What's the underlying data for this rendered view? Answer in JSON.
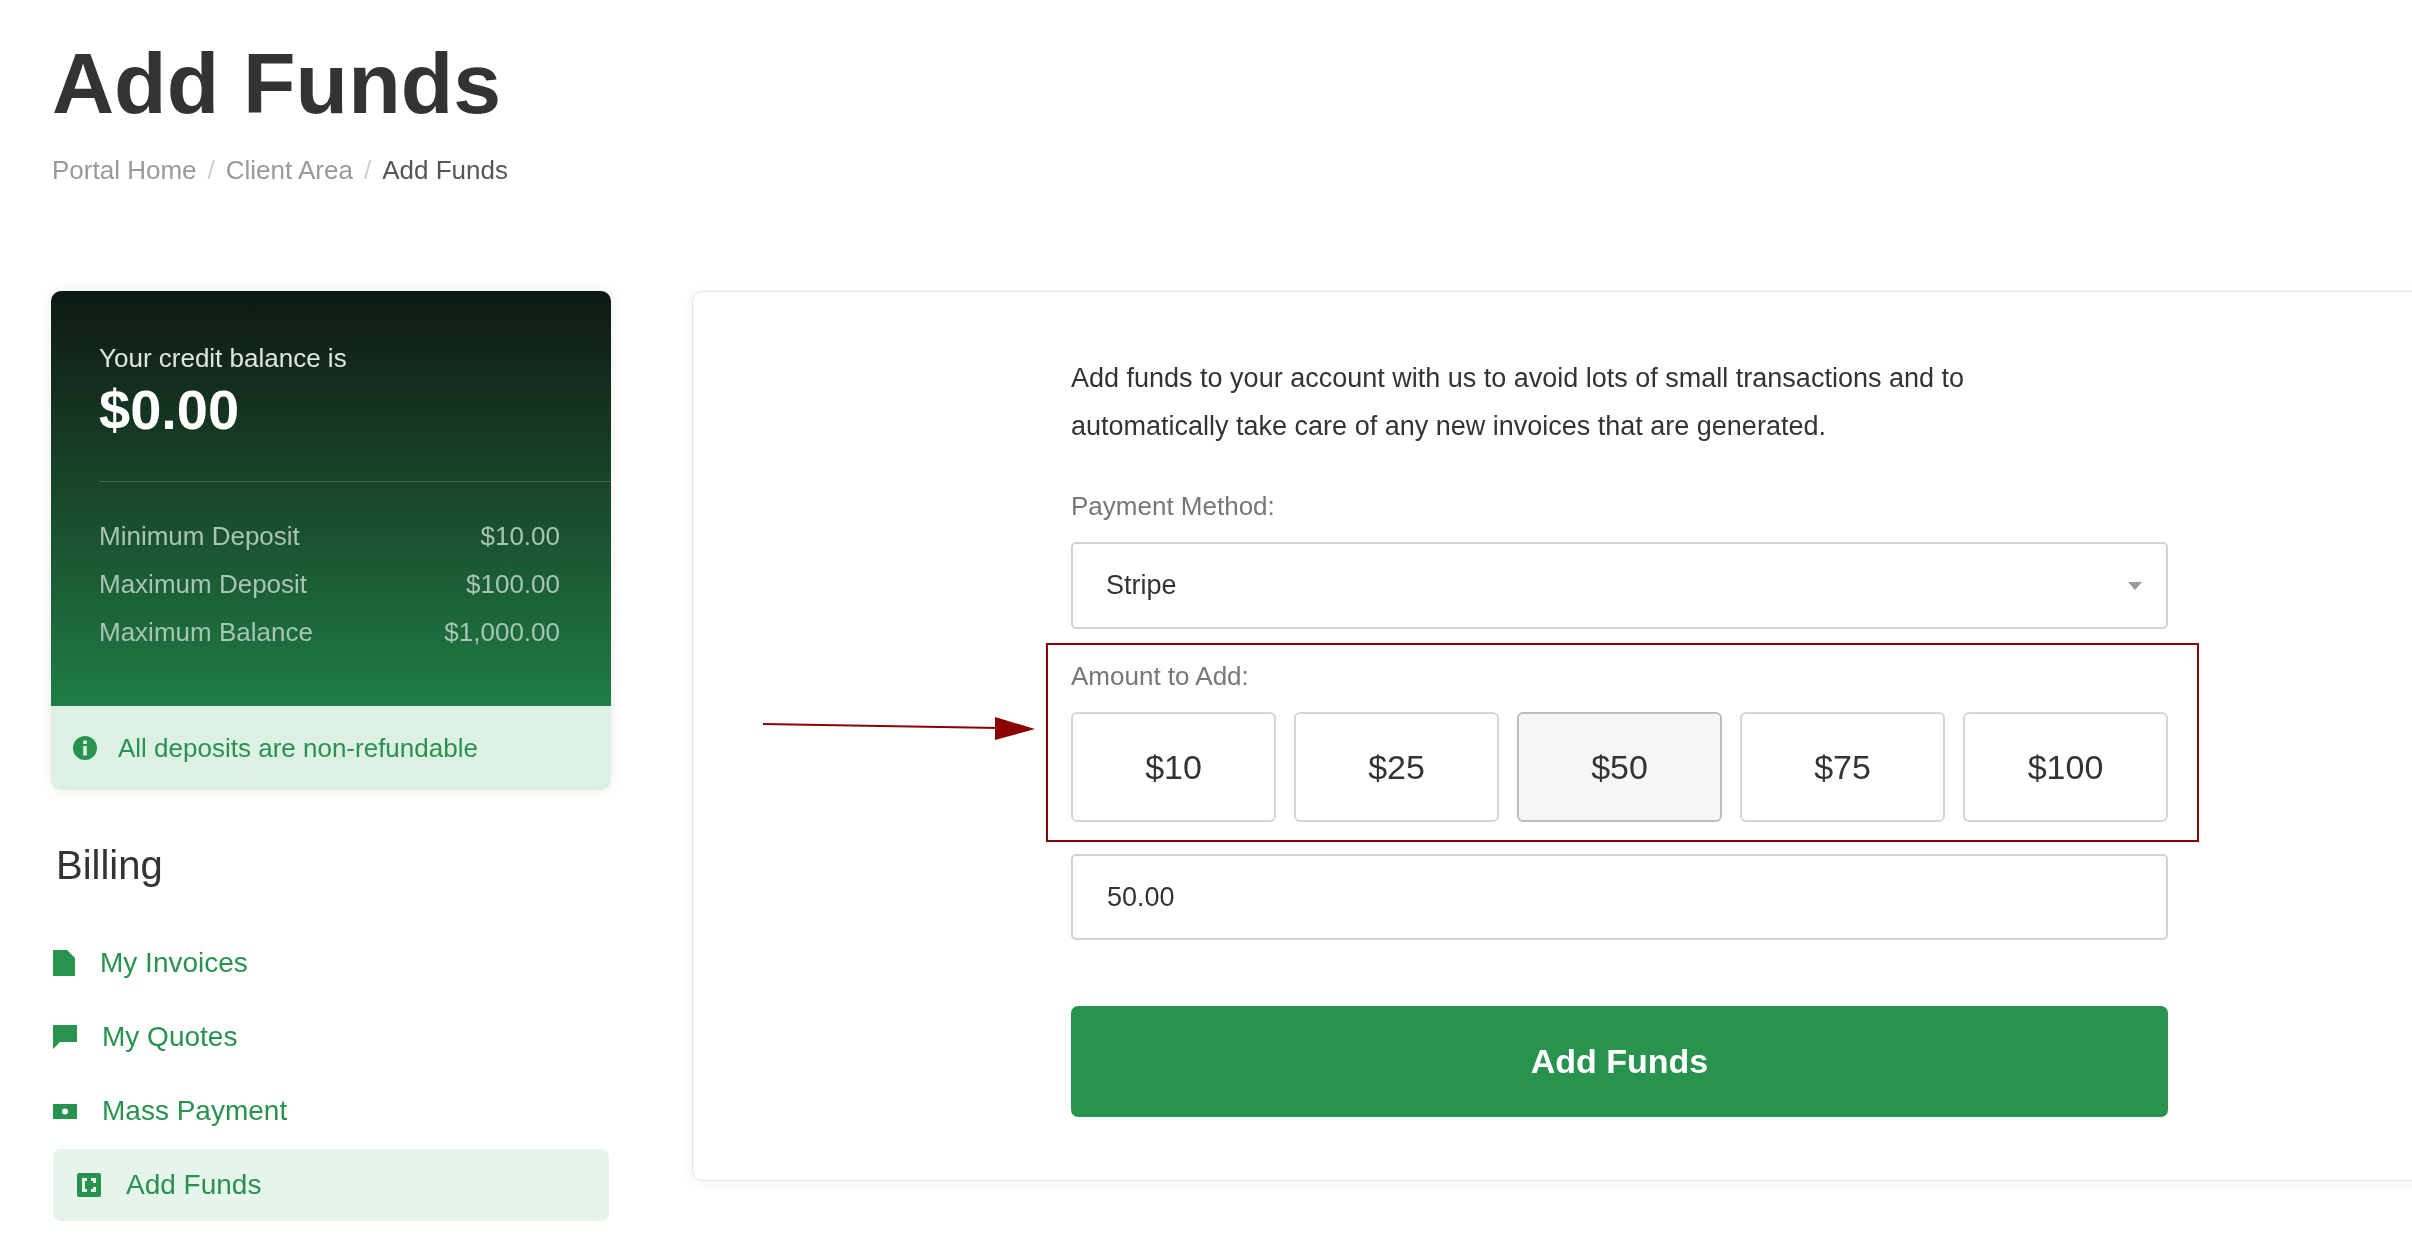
{
  "page": {
    "title": "Add Funds"
  },
  "breadcrumb": {
    "separator": "/",
    "items": [
      {
        "label": "Portal Home",
        "current": false
      },
      {
        "label": "Client Area",
        "current": false
      },
      {
        "label": "Add Funds",
        "current": true
      }
    ]
  },
  "credit_card": {
    "caption": "Your credit balance is",
    "balance": "$0.00",
    "limits": [
      {
        "label": "Minimum Deposit",
        "value": "$10.00"
      },
      {
        "label": "Maximum Deposit",
        "value": "$100.00"
      },
      {
        "label": "Maximum Balance",
        "value": "$1,000.00"
      }
    ],
    "notice": "All deposits are non-refundable"
  },
  "sidebar": {
    "heading": "Billing",
    "items": [
      {
        "label": "My Invoices",
        "selected": false
      },
      {
        "label": "My Quotes",
        "selected": false
      },
      {
        "label": "Mass Payment",
        "selected": false
      },
      {
        "label": "Add Funds",
        "selected": true
      }
    ]
  },
  "form": {
    "intro": "Add funds to your account with us to avoid lots of small transactions and to automatically take care of any new invoices that are generated.",
    "payment_method": {
      "label": "Payment Method:",
      "value": "Stripe"
    },
    "amount": {
      "label": "Amount to Add:",
      "presets": [
        {
          "label": "$10",
          "selected": false
        },
        {
          "label": "$25",
          "selected": false
        },
        {
          "label": "$50",
          "selected": true
        },
        {
          "label": "$75",
          "selected": false
        },
        {
          "label": "$100",
          "selected": false
        }
      ],
      "value": "50.00"
    },
    "submit": "Add Funds"
  }
}
